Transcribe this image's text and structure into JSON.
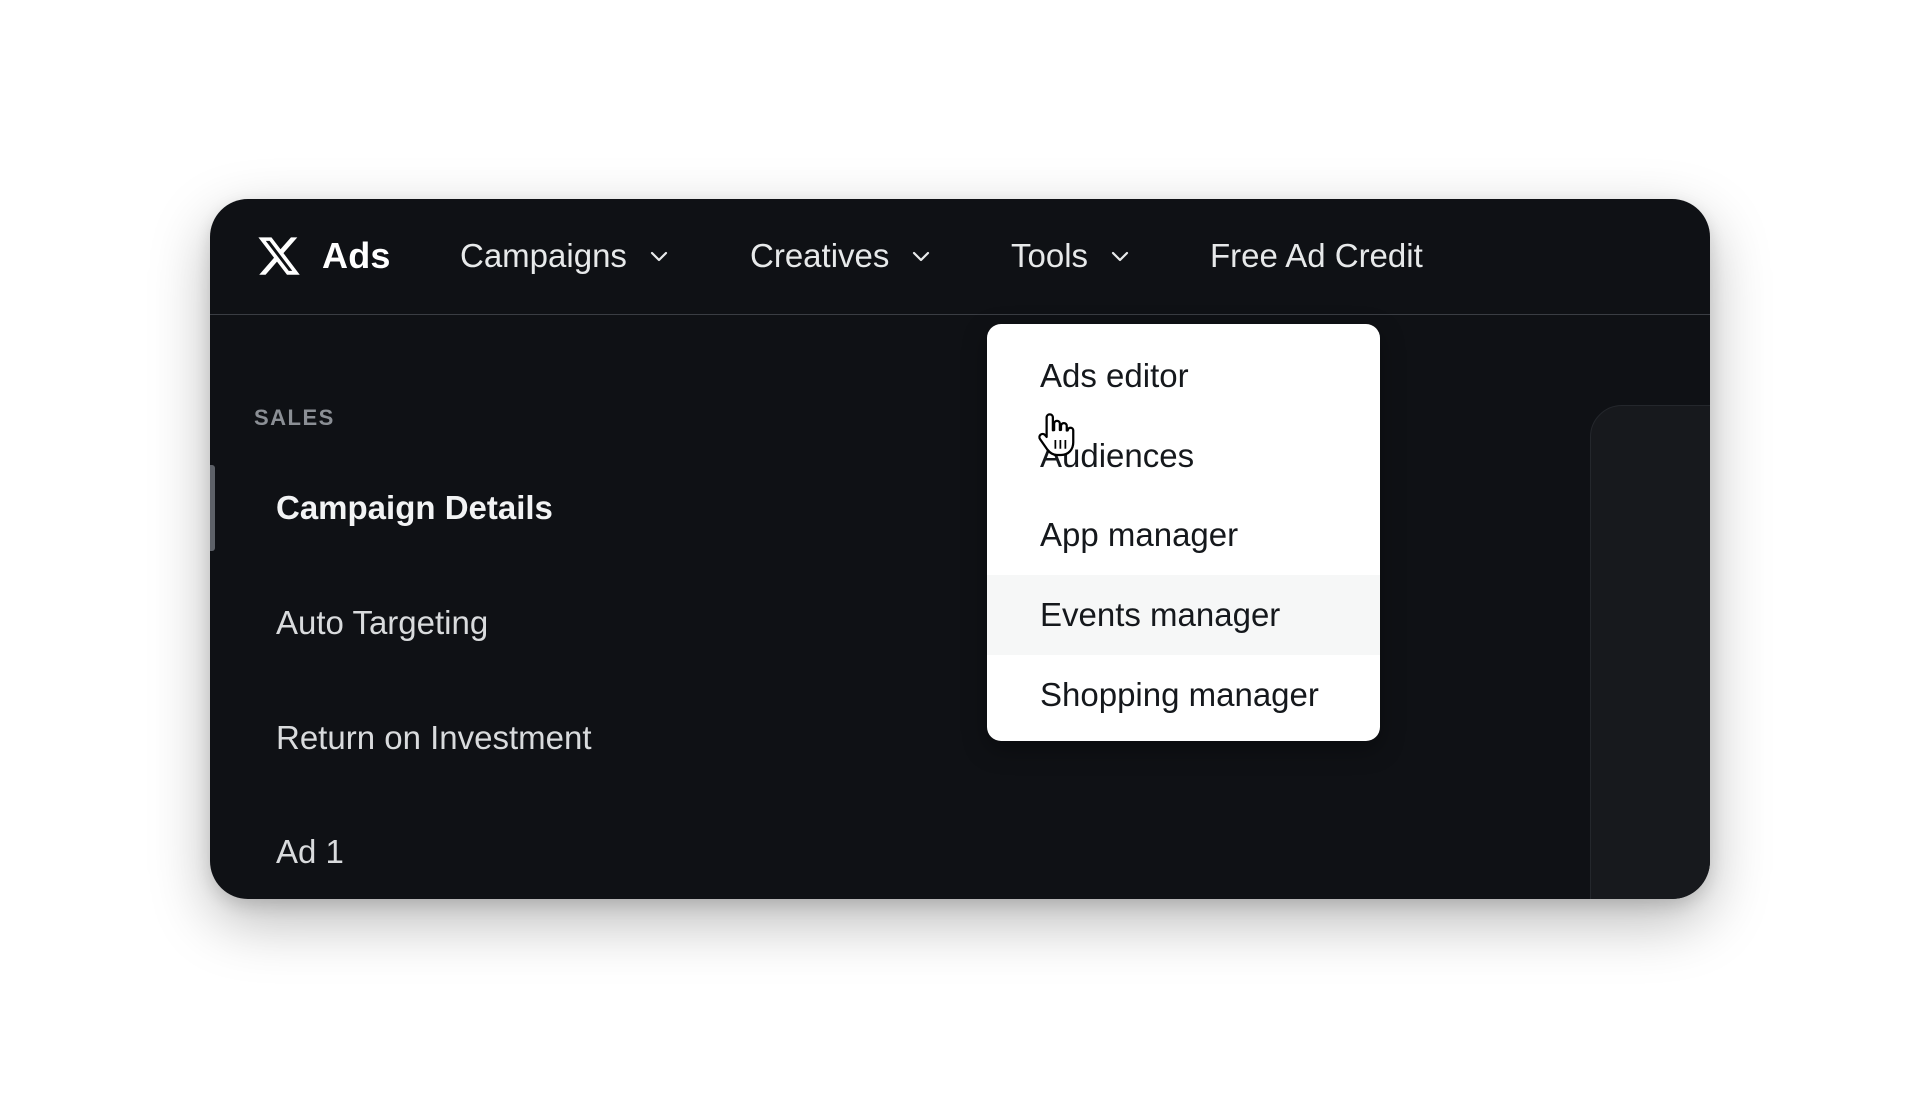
{
  "brand": {
    "label": "Ads",
    "icon": "x-logo-icon"
  },
  "nav": {
    "items": [
      {
        "label": "Campaigns",
        "has_dropdown": true
      },
      {
        "label": "Creatives",
        "has_dropdown": true
      },
      {
        "label": "Tools",
        "has_dropdown": true,
        "open": true
      },
      {
        "label": "Free Ad Credit",
        "has_dropdown": false
      }
    ]
  },
  "sidebar": {
    "section_label": "SALES",
    "items": [
      {
        "label": "Campaign Details",
        "active": true
      },
      {
        "label": "Auto Targeting"
      },
      {
        "label": "Return on Investment"
      },
      {
        "label": "Ad 1"
      }
    ]
  },
  "tools_menu": {
    "items": [
      {
        "label": "Ads editor"
      },
      {
        "label": "Audiences"
      },
      {
        "label": "App manager"
      },
      {
        "label": "Events manager",
        "hovered": true
      },
      {
        "label": "Shopping manager"
      }
    ]
  },
  "colors": {
    "window_bg": "#0f1115",
    "menu_bg": "#ffffff",
    "menu_hover_bg": "#f6f7f7",
    "nav_text": "#e7e9ea",
    "section_label": "#8b8f95"
  }
}
